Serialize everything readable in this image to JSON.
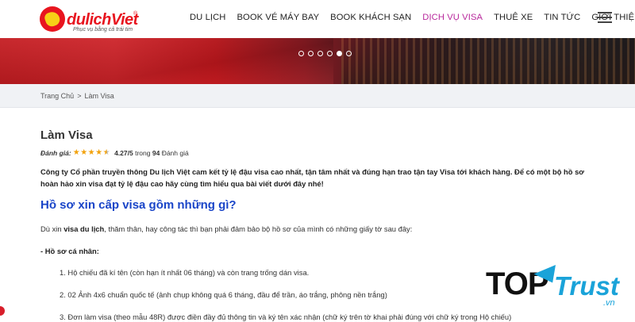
{
  "logo": {
    "text": "dulichViet",
    "registered": "®",
    "tagline": "Phục vụ bằng cả trái tim"
  },
  "nav": {
    "items": [
      {
        "label": "DU LỊCH"
      },
      {
        "label": "BOOK VÉ MÁY BAY"
      },
      {
        "label": "BOOK KHÁCH SẠN"
      },
      {
        "label": "DỊCH VỤ VISA"
      },
      {
        "label": "THUÊ XE"
      },
      {
        "label": "TIN TỨC"
      },
      {
        "label": "GIỚI THIỆU"
      }
    ],
    "active_index": 3
  },
  "banner": {
    "slide_count": 6,
    "active_slide": 5
  },
  "breadcrumb": {
    "home": "Trang Chủ",
    "separator": ">",
    "current": "Làm Visa"
  },
  "page": {
    "title": "Làm Visa",
    "rating": {
      "label": "Đánh giá:",
      "score": "4.27/5",
      "middle": "trong",
      "count": "94",
      "suffix": "Đánh giá",
      "stars_value": 4.27
    },
    "intro": "Công ty Cổ phần truyền thông Du lịch Việt cam kết tỷ lệ đậu visa cao nhất, tận tâm nhất và đúng hạn trao tận tay Visa tới khách hàng. Để có một bộ hồ sơ hoàn hảo xin visa đạt tỷ lệ đậu cao hãy cùng tìm hiểu qua bài viết dưới đây nhé!",
    "heading": "Hồ sơ xin cấp visa gồm những gì?",
    "para_before": "Dù xin ",
    "para_bold": "visa du lịch",
    "para_after": ", thăm thân, hay công tác thì bạn phải đảm bảo bộ hồ sơ của mình có những giấy tờ sau đây:",
    "subhead": "- Hồ sơ cá nhân:",
    "list": [
      "1. Hộ chiếu đã kí tên (còn hạn ít nhất 06 tháng) và còn trang trống dán visa.",
      "2. 02 Ảnh 4x6 chuẩn quốc tế (ảnh chụp không quá 6 tháng, đầu để trần, áo trắng, phông nền trắng)",
      "3. Đơn làm visa (theo mẫu 48R) được điền đầy đủ thông tin và ký tên xác nhận (chữ ký trên tờ khai phải đúng với chữ ký trong Hộ chiếu)"
    ]
  },
  "watermark": {
    "top": "TOP",
    "trust": "Trust",
    "vn": ".vn"
  },
  "colors": {
    "brand_red": "#e8151f",
    "nav_active": "#b8289c",
    "heading_blue": "#1a45c8",
    "star": "#f2a20c",
    "watermark_blue": "#1aa3d9"
  }
}
